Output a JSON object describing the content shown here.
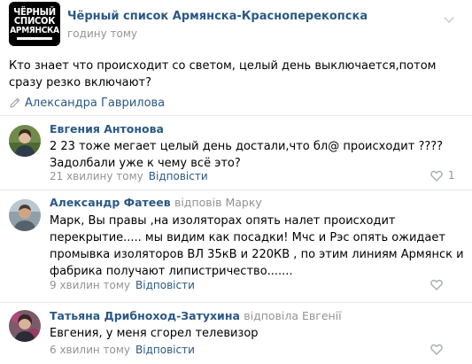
{
  "group": {
    "logo_lines": [
      "ЧЁРНЫЙ",
      "СПИСОК",
      "АРМЯНСКА"
    ],
    "name": "Чёрный список Армянска-Красноперекопска",
    "time": "годину тому"
  },
  "post": {
    "text": "Кто знает что происходит со светом, целый день выключается,потом сразу резко включают?",
    "author_icon": "pencil-icon",
    "author": "Александра Гаврилова"
  },
  "comments": [
    {
      "name": "Евгения Антонова",
      "reply_to": "",
      "text": "2 23 тоже мегает целый день достали,что бл@ происходит ???? Задолбали уже к чему всё это?",
      "time": "21 хвилину тому",
      "reply_label": "Відповісти",
      "likes": "1"
    },
    {
      "name": "Александр Фатеев",
      "reply_to": "відповів Марку",
      "text": "Марк, Вы правы ,на изоляторах опять налет происходит перекрытие..... мы видим как посадки! Мчс и Рэс опять ожидает промывка изоляторов ВЛ 35кВ и 220КВ , по этим линиям Армянск и фабрика получают липистричество.......",
      "time": "9 хвилин тому",
      "reply_label": "Відповісти",
      "likes": ""
    },
    {
      "name": "Татьяна Дрибноход-Затухина",
      "reply_to": "відповіла Евгенії",
      "text": "Евгения, у меня сгорел телевизор",
      "time": "6 хвилин тому",
      "reply_label": "Відповісти",
      "likes": ""
    }
  ],
  "colors": {
    "link": "#2a5885",
    "meta": "#939393",
    "divider": "#e7e8ec"
  }
}
